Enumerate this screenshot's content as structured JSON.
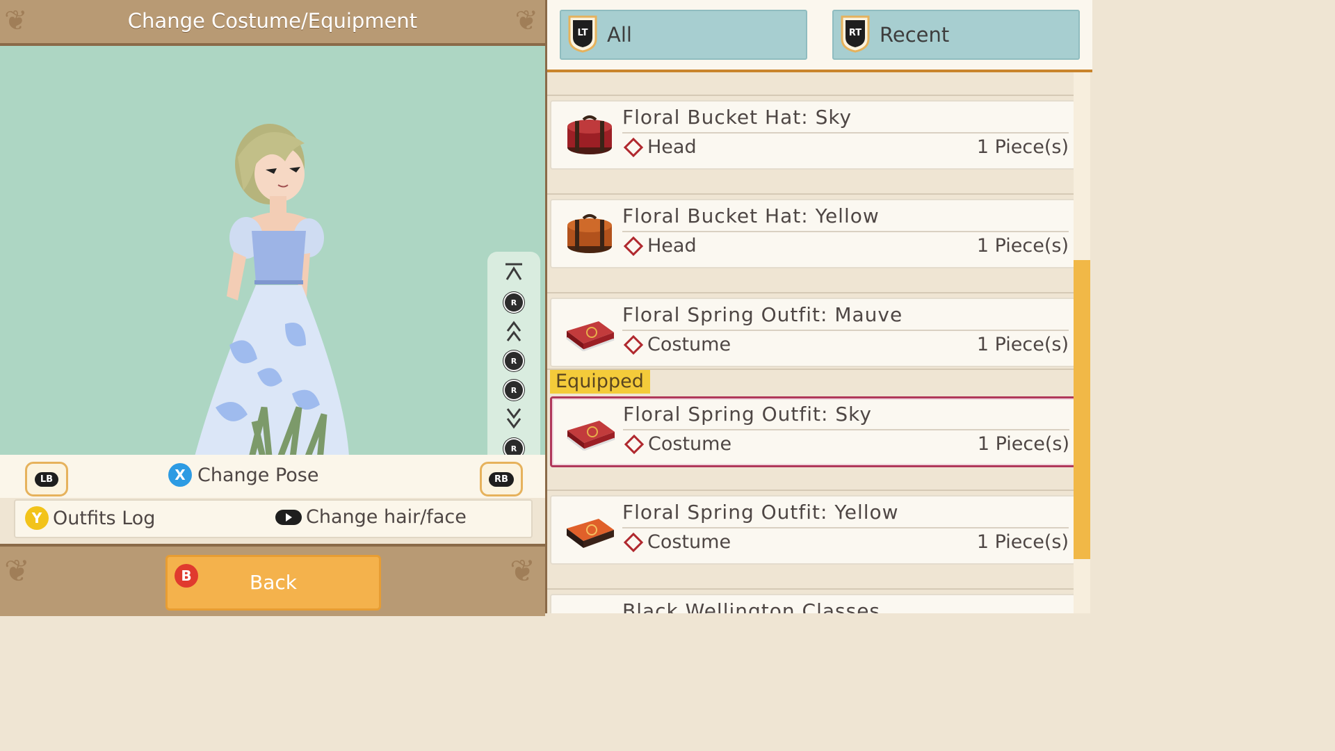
{
  "header": {
    "title": "Change Costume/Equipment"
  },
  "controls": {
    "lb": "LB",
    "rb": "RB",
    "change_pose_btn": "X",
    "change_pose_label": "Change Pose",
    "outfits_log_btn": "Y",
    "outfits_log_label": "Outfits Log",
    "change_hair_label": "Change hair/face",
    "back_btn": "B",
    "back_label": "Back",
    "camera_stick": "R"
  },
  "tabs": [
    {
      "button": "LT",
      "label": "All"
    },
    {
      "button": "RT",
      "label": "Recent"
    }
  ],
  "equipped_label": "Equipped",
  "items": [
    {
      "name": "Floral Bucket Hat: Sky",
      "slot": "Head",
      "qty": "1 Piece(s)",
      "color": "#9c1f25"
    },
    {
      "name": "Floral Bucket Hat: Yellow",
      "slot": "Head",
      "qty": "1 Piece(s)",
      "color": "#b2521c"
    },
    {
      "name": "Floral Spring Outfit: Mauve",
      "slot": "Costume",
      "qty": "1 Piece(s)",
      "color": "#a91e2a"
    },
    {
      "name": "Floral Spring Outfit: Sky",
      "slot": "Costume",
      "qty": "1 Piece(s)",
      "color": "#a91e2a"
    },
    {
      "name": "Floral Spring Outfit: Yellow",
      "slot": "Costume",
      "qty": "1 Piece(s)",
      "color": "#c4441f"
    },
    {
      "name": "Black Wellington Classes"
    }
  ],
  "colors": {
    "accent": "#f4b24c",
    "equipped_border": "#b0385a",
    "tab_bg": "#a7ced0",
    "viewport_bg": "#add6c3"
  }
}
